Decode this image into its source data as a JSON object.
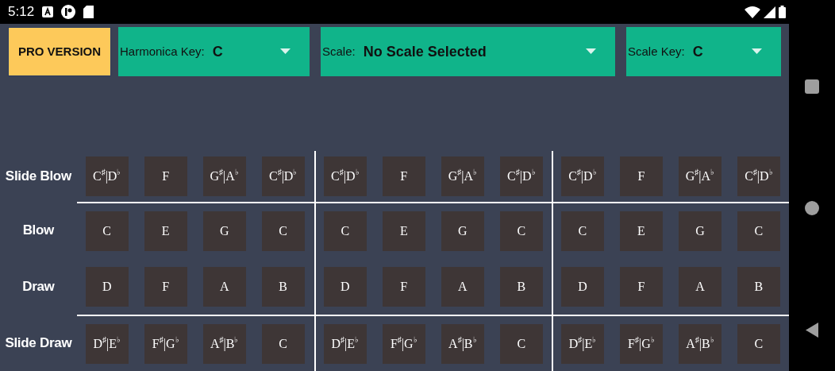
{
  "status_bar": {
    "time": "5:12"
  },
  "toolbar": {
    "pro_button": "PRO VERSION",
    "dropdowns": [
      {
        "label": "Harmonica Key:",
        "value": "C"
      },
      {
        "label": "Scale:",
        "value": "No Scale Selected"
      },
      {
        "label": "Scale Key:",
        "value": "C"
      }
    ]
  },
  "note_rows": [
    {
      "label": "Slide Blow",
      "notes": [
        "C$^{♯}$|D$^{♭}$",
        "F",
        "G$^{♯}$|A$^{♭}$",
        "C$^{♯}$|D$^{♭}$",
        "C$^{♯}$|D$^{♭}$",
        "F",
        "G$^{♯}$|A$^{♭}$",
        "C$^{♯}$|D$^{♭}$",
        "C$^{♯}$|D$^{♭}$",
        "F",
        "G$^{♯}$|A$^{♭}$",
        "C$^{♯}$|D$^{♭}$"
      ]
    },
    {
      "label": "Blow",
      "notes": [
        "C",
        "E",
        "G",
        "C",
        "C",
        "E",
        "G",
        "C",
        "C",
        "E",
        "G",
        "C"
      ]
    },
    {
      "label": "Draw",
      "notes": [
        "D",
        "F",
        "A",
        "B",
        "D",
        "F",
        "A",
        "B",
        "D",
        "F",
        "A",
        "B"
      ]
    },
    {
      "label": "Slide Draw",
      "notes": [
        "D$^{♯}$|E$^{♭}$",
        "F$^{♯}$|G$^{♭}$",
        "A$^{♯}$|B$^{♭}$",
        "C",
        "D$^{♯}$|E$^{♭}$",
        "F$^{♯}$|G$^{♭}$",
        "A$^{♯}$|B$^{♭}$",
        "C",
        "D$^{♯}$|E$^{♭}$",
        "F$^{♯}$|G$^{♭}$",
        "A$^{♯}$|B$^{♭}$",
        "C"
      ]
    }
  ]
}
